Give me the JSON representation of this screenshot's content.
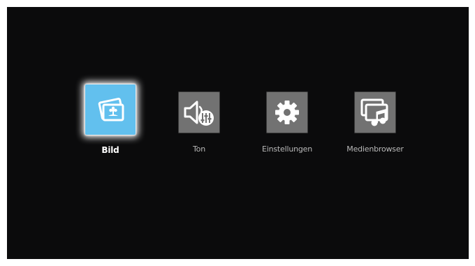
{
  "menu": {
    "selected_index": 0,
    "accent_color": "#62c0ee",
    "items": [
      {
        "label": "Bild",
        "icon": "picture-icon",
        "selected": true
      },
      {
        "label": "Ton",
        "icon": "sound-settings-icon",
        "selected": false
      },
      {
        "label": "Einstellungen",
        "icon": "gear-icon",
        "selected": false
      },
      {
        "label": "Medienbrowser",
        "icon": "media-browser-icon",
        "selected": false
      }
    ]
  }
}
